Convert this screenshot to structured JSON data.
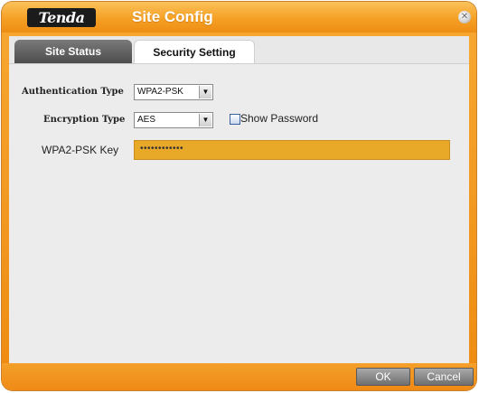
{
  "window": {
    "brand": "Tenda",
    "title": "Site Config",
    "close_icon": "close-icon"
  },
  "tabs": [
    {
      "label": "Site Status",
      "active": false
    },
    {
      "label": "Security Setting",
      "active": true
    }
  ],
  "form": {
    "auth_label": "Authentication Type",
    "auth_value": "WPA2-PSK",
    "enc_label": "Encryption Type",
    "enc_value": "AES",
    "show_password_label": "Show Password",
    "show_password_checked": false,
    "key_label": "WPA2-PSK Key",
    "key_value": "••••••••••••"
  },
  "buttons": {
    "ok": "OK",
    "cancel": "Cancel"
  },
  "colors": {
    "accent": "#f39a1f",
    "key_field": "#e9a928"
  }
}
